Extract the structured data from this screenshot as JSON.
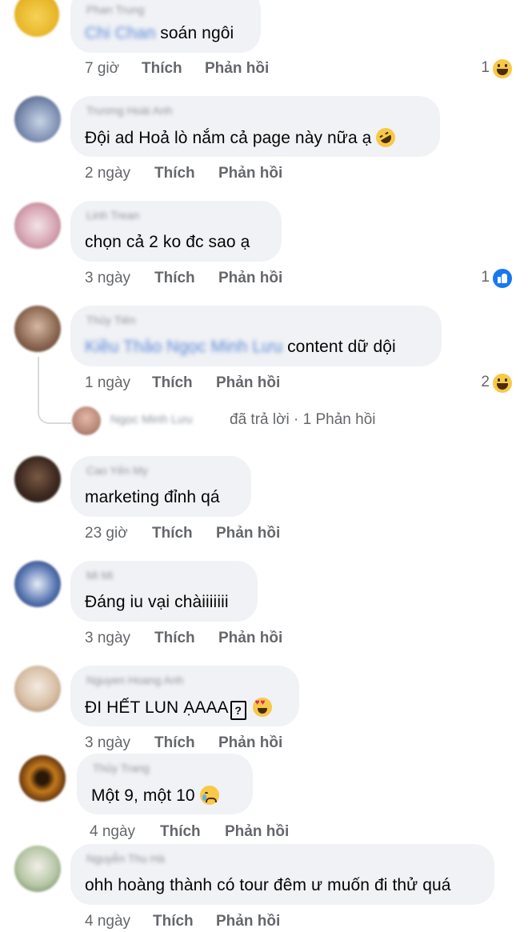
{
  "actions": {
    "like": "Thích",
    "reply": "Phản hồi"
  },
  "colors": {
    "bubble": "#f0f2f5",
    "meta": "#65676b",
    "mention": "#5b86d6",
    "like_blue": "#1877f2",
    "emoji_yellow": "#f7c948"
  },
  "comments": [
    {
      "name": "Phan Trung",
      "mention": "Chi Chan",
      "text": "soán ngôi",
      "time": "7 giờ",
      "reaction_count": "1",
      "reaction_icon": "laugh-emoji"
    },
    {
      "name": "Trương Hoài Anh",
      "mention": "",
      "text": "Đội ad Hoả lò nắm cả page này nữa ạ",
      "emoji": "rofl-emoji",
      "time": "2 ngày",
      "reaction_count": "",
      "reaction_icon": ""
    },
    {
      "name": "Linh Trean",
      "mention": "",
      "text": "chọn cả 2 ko đc sao ạ",
      "time": "3 ngày",
      "reaction_count": "1",
      "reaction_icon": "like-icon"
    },
    {
      "name": "Thủy Tiên",
      "mention": "Kiều Thảo Ngọc Minh Lưu",
      "text": "content dữ dội",
      "time": "1 ngày",
      "reaction_count": "2",
      "reaction_icon": "laugh-emoji"
    },
    {
      "name": "Cao Yến My",
      "mention": "",
      "text": "marketing đỉnh qá",
      "time": "23 giờ",
      "reaction_count": "",
      "reaction_icon": ""
    },
    {
      "name": "Mi Mi",
      "mention": "",
      "text": "Đáng iu vại chàiiiiiii",
      "time": "3 ngày",
      "reaction_count": "",
      "reaction_icon": ""
    },
    {
      "name": "Nguyen Hoang Anh",
      "mention": "",
      "text": "ĐI HẾT LUN ẠAAA",
      "glyph": "?",
      "emoji": "heart-eyes-emoji",
      "time": "3 ngày",
      "reaction_count": "",
      "reaction_icon": ""
    },
    {
      "name": "Thủy Trang",
      "mention": "",
      "text": "Một 9, một 10",
      "emoji": "crying-emoji",
      "time": "4 ngày",
      "reaction_count": "",
      "reaction_icon": ""
    },
    {
      "name": "Nguyễn Thu Hà",
      "mention": "",
      "text": "ohh hoàng thành có tour đêm ư muốn đi thử quá",
      "time": "4 ngày",
      "reaction_count": "",
      "reaction_icon": ""
    }
  ],
  "thread_reply": {
    "name": "Ngọc Minh Lưu",
    "text": "đã trả lời · 1 Phản hồi"
  }
}
